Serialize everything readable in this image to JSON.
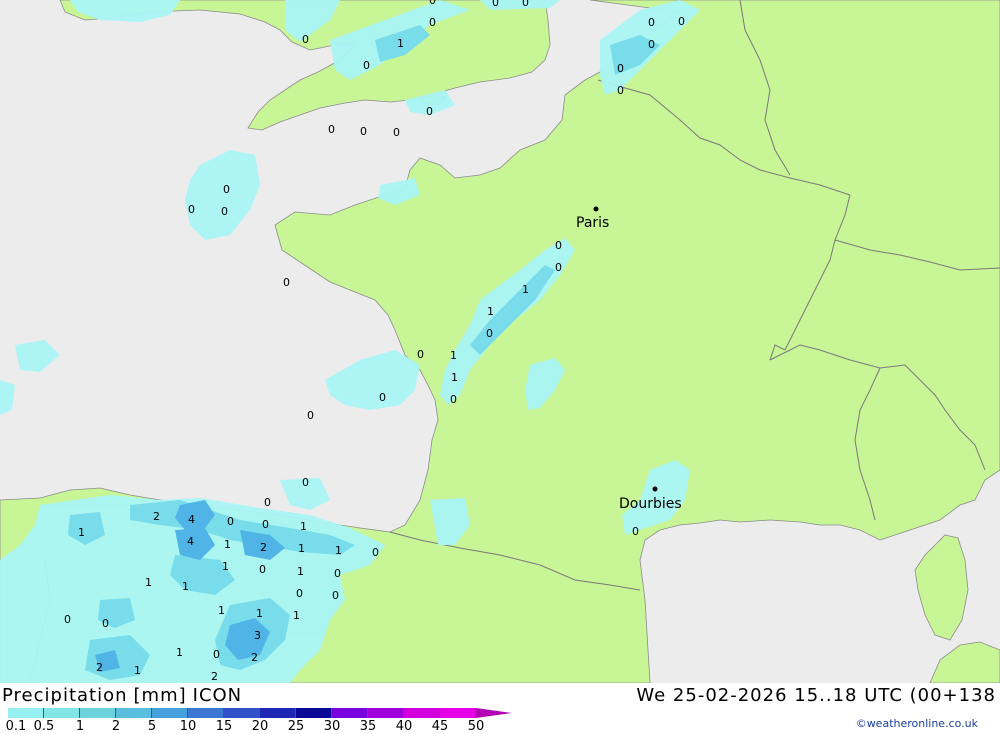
{
  "title": "Precipitation [mm] ICON",
  "title_parts": [
    "Precipitation",
    "[mm]",
    "ICON"
  ],
  "datetime": "We 25-02-2026 15..18 UTC (00+138",
  "credit": "©weatheronline.co.uk",
  "legend": {
    "values": [
      "0.1",
      "0.5",
      "1",
      "2",
      "5",
      "10",
      "15",
      "20",
      "25",
      "30",
      "35",
      "40",
      "45",
      "50"
    ],
    "colors": [
      "#96f0f0",
      "#82e6e6",
      "#6ed2dc",
      "#5abede",
      "#46a0dc",
      "#3c78d2",
      "#3250c8",
      "#1e28b4",
      "#0a0a96",
      "#7800dc",
      "#a000dc",
      "#d200dc",
      "#e600e6",
      "#b400b4"
    ]
  },
  "colors": {
    "sea": "#ececec",
    "land": "#c8f596",
    "border": "#8c8c8c",
    "precip_light": "#aaf5f5",
    "precip_mid": "#78dcea",
    "precip_heavy": "#50b4e6"
  },
  "cities": [
    {
      "name": "Paris"
    },
    {
      "name": "Dourbies"
    }
  ],
  "value_labels": [
    "0",
    "0",
    "0",
    "0",
    "0",
    "0",
    "1",
    "0",
    "0",
    "0",
    "0",
    "0",
    "0",
    "0",
    "0",
    "0",
    "0",
    "0",
    "0",
    "0",
    "1",
    "0",
    "1",
    "1",
    "0",
    "0",
    "0",
    "1",
    "0",
    "0",
    "0",
    "0",
    "0",
    "1",
    "4",
    "2",
    "0",
    "0",
    "1",
    "4",
    "1",
    "2",
    "1",
    "1",
    "0",
    "1",
    "1",
    "0",
    "1",
    "1",
    "0",
    "0",
    "0",
    "1",
    "1",
    "1",
    "0",
    "3",
    "0",
    "1",
    "0",
    "2",
    "2",
    "1",
    "2",
    "0"
  ]
}
